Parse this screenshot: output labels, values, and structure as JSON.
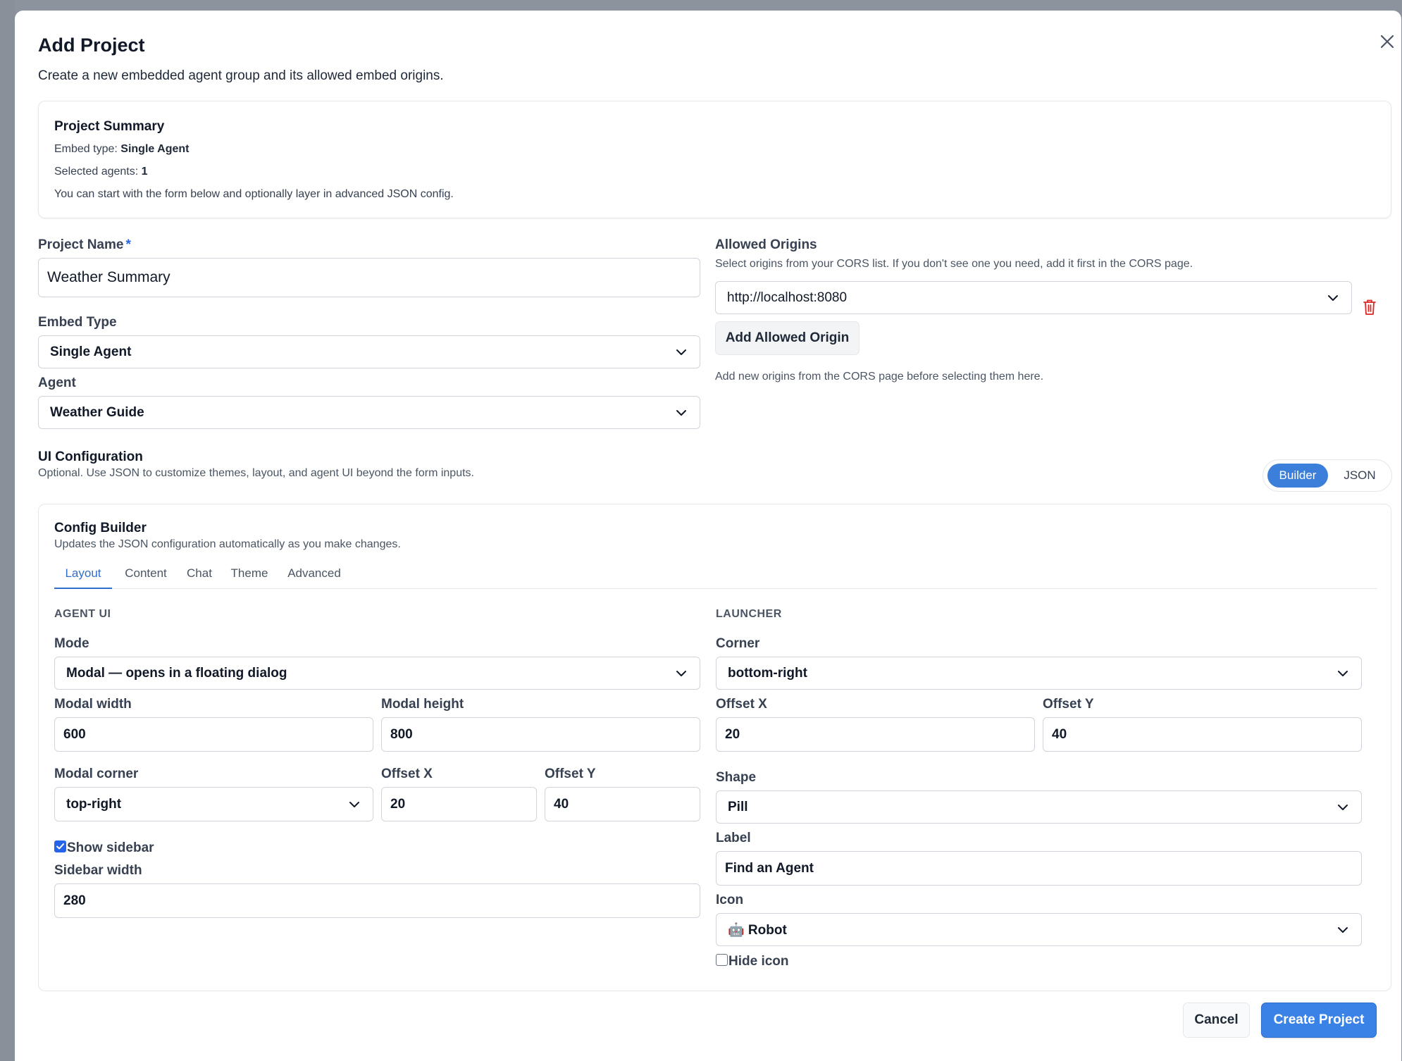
{
  "modal": {
    "title": "Add Project",
    "description": "Create a new embedded agent group and its allowed embed origins."
  },
  "summary": {
    "title": "Project Summary",
    "embed_type_label": "Embed type:",
    "embed_type_value": "Single Agent",
    "selected_agents_label": "Selected agents:",
    "selected_agents_value": "1",
    "note": "You can start with the form below and optionally layer in advanced JSON config."
  },
  "project_name": {
    "label": "Project Name",
    "required_mark": "*",
    "value": "Weather Summary"
  },
  "embed_type": {
    "label": "Embed Type",
    "value": "Single Agent"
  },
  "agent": {
    "label": "Agent",
    "value": "Weather Guide"
  },
  "allowed_origins": {
    "label": "Allowed Origins",
    "help": "Select origins from your CORS list. If you don't see one you need, add it first in the CORS page.",
    "origins": [
      "http://localhost:8080"
    ],
    "add_button": "Add Allowed Origin",
    "footer_help": "Add new origins from the CORS page before selecting them here."
  },
  "ui_config": {
    "title": "UI Configuration",
    "description": "Optional. Use JSON to customize themes, layout, and agent UI beyond the form inputs.",
    "toggle": {
      "builder": "Builder",
      "json": "JSON",
      "active": "Builder"
    }
  },
  "config_builder": {
    "title": "Config Builder",
    "description": "Updates the JSON configuration automatically as you make changes.",
    "tabs": [
      "Layout",
      "Content",
      "Chat",
      "Theme",
      "Advanced"
    ],
    "active_tab": "Layout",
    "agent_ui": {
      "heading": "AGENT UI",
      "mode_label": "Mode",
      "mode_value": "Modal — opens in a floating dialog",
      "modal_width_label": "Modal width",
      "modal_width_value": "600",
      "modal_height_label": "Modal height",
      "modal_height_value": "800",
      "modal_corner_label": "Modal corner",
      "modal_corner_value": "top-right",
      "offset_x_label": "Offset X",
      "offset_x_value": "20",
      "offset_y_label": "Offset Y",
      "offset_y_value": "40",
      "show_sidebar_label": "Show sidebar",
      "show_sidebar_checked": true,
      "sidebar_width_label": "Sidebar width",
      "sidebar_width_value": "280"
    },
    "launcher": {
      "heading": "LAUNCHER",
      "corner_label": "Corner",
      "corner_value": "bottom-right",
      "offset_x_label": "Offset X",
      "offset_x_value": "20",
      "offset_y_label": "Offset Y",
      "offset_y_value": "40",
      "shape_label": "Shape",
      "shape_value": "Pill",
      "label_label": "Label",
      "label_value": "Find an Agent",
      "icon_label": "Icon",
      "icon_value": "🤖 Robot",
      "hide_icon_label": "Hide icon",
      "hide_icon_checked": false
    }
  },
  "footer": {
    "cancel": "Cancel",
    "create": "Create Project"
  },
  "colors": {
    "primary": "#3b82e6",
    "accent_text": "#2f6fcb",
    "danger": "#dc2626",
    "backdrop": "#8d939c"
  }
}
